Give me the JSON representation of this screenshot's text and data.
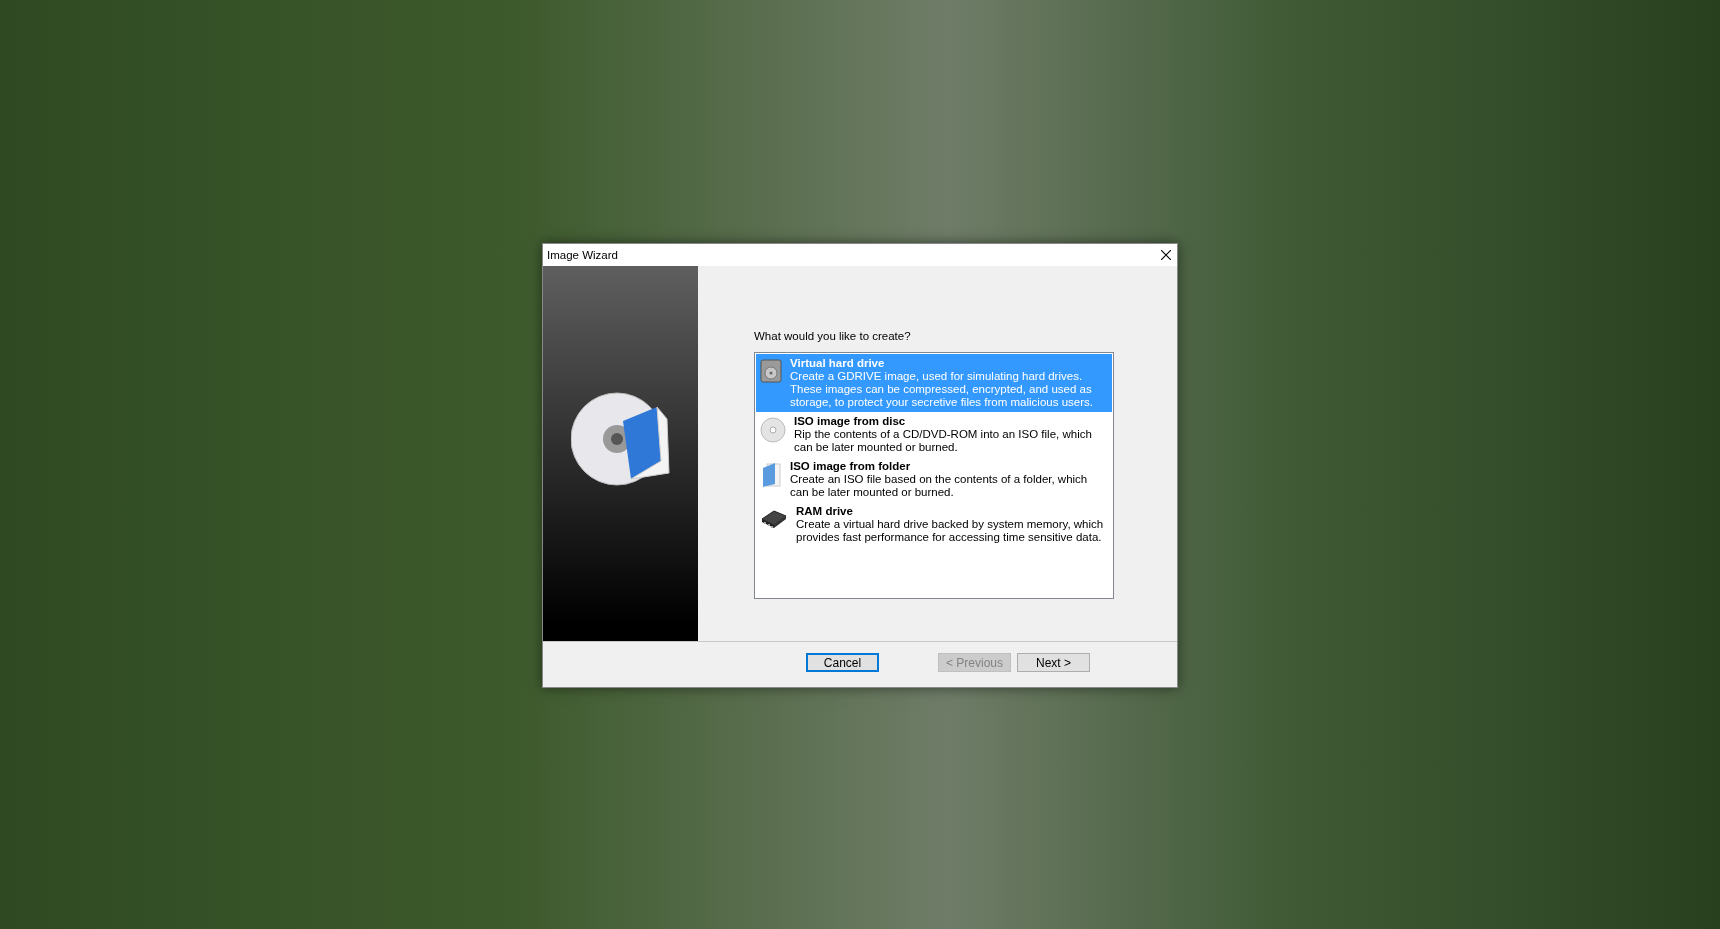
{
  "window": {
    "title": "Image Wizard"
  },
  "prompt": "What would you like to create?",
  "options": [
    {
      "kind": "hdd",
      "title": "Virtual hard drive",
      "description": "Create a GDRIVE image, used for simulating hard drives. These images can be compressed, encrypted, and used as storage, to protect your secretive files from malicious users.",
      "selected": true
    },
    {
      "kind": "disc",
      "title": "ISO image from disc",
      "description": "Rip the contents of a CD/DVD-ROM into an ISO file, which can be later mounted or burned.",
      "selected": false
    },
    {
      "kind": "folder",
      "title": "ISO image from folder",
      "description": "Create an ISO file based on the contents of a folder, which can be later mounted or burned.",
      "selected": false
    },
    {
      "kind": "chip",
      "title": "RAM drive",
      "description": "Create a virtual hard drive backed by system memory, which provides fast performance for accessing time sensitive data.",
      "selected": false
    }
  ],
  "buttons": [
    {
      "label": "Cancel",
      "focused": true,
      "disabled": false
    },
    {
      "label": "< Previous",
      "focused": false,
      "disabled": true
    },
    {
      "label": "Next >",
      "focused": false,
      "disabled": false
    }
  ]
}
